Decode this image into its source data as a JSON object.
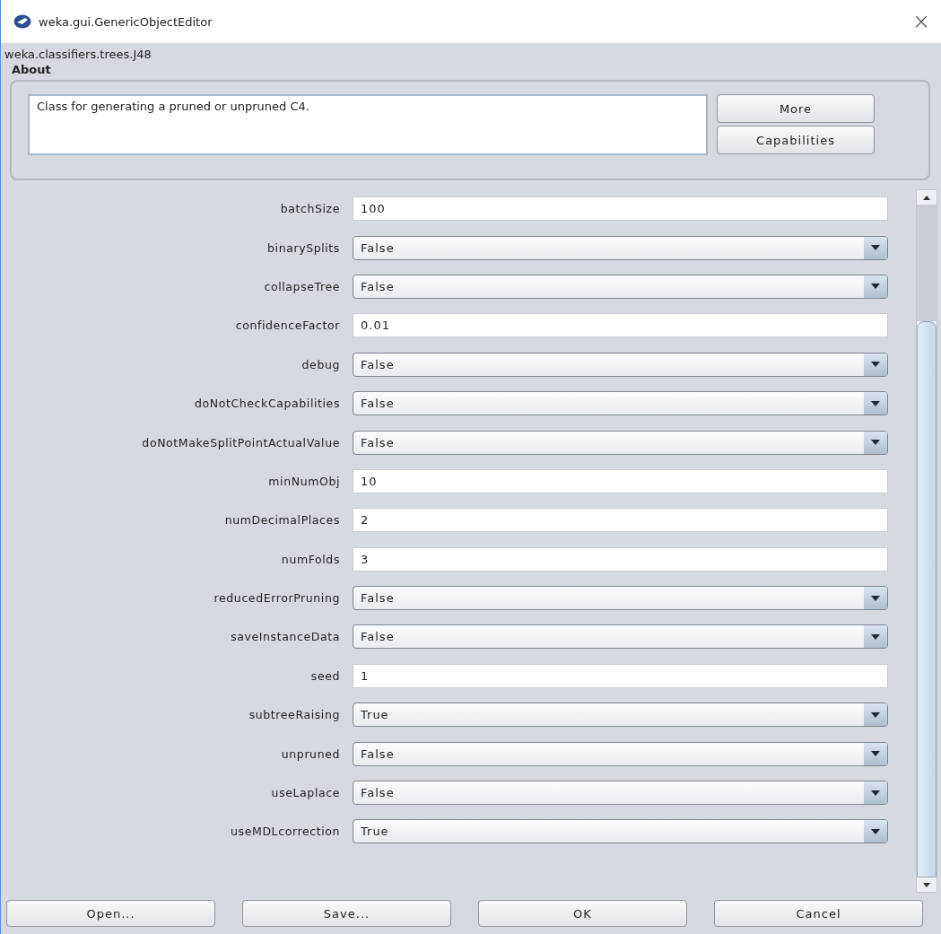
{
  "window": {
    "title": "weka.gui.GenericObjectEditor",
    "close": "×"
  },
  "class_name": "weka.classifiers.trees.J48",
  "about": {
    "heading": "About",
    "description": "Class for generating a pruned or unpruned C4.",
    "buttons": [
      "More",
      "Capabilities"
    ]
  },
  "properties": [
    {
      "label": "batchSize",
      "kind": "text",
      "value": "100"
    },
    {
      "label": "binarySplits",
      "kind": "dropdown",
      "value": "False"
    },
    {
      "label": "collapseTree",
      "kind": "dropdown",
      "value": "False"
    },
    {
      "label": "confidenceFactor",
      "kind": "text",
      "value": "0.01"
    },
    {
      "label": "debug",
      "kind": "dropdown",
      "value": "False"
    },
    {
      "label": "doNotCheckCapabilities",
      "kind": "dropdown",
      "value": "False"
    },
    {
      "label": "doNotMakeSplitPointActualValue",
      "kind": "dropdown",
      "value": "False"
    },
    {
      "label": "minNumObj",
      "kind": "text",
      "value": "10"
    },
    {
      "label": "numDecimalPlaces",
      "kind": "text",
      "value": "2"
    },
    {
      "label": "numFolds",
      "kind": "text",
      "value": "3"
    },
    {
      "label": "reducedErrorPruning",
      "kind": "dropdown",
      "value": "False"
    },
    {
      "label": "saveInstanceData",
      "kind": "dropdown",
      "value": "False"
    },
    {
      "label": "seed",
      "kind": "text",
      "value": "1"
    },
    {
      "label": "subtreeRaising",
      "kind": "dropdown",
      "value": "True"
    },
    {
      "label": "unpruned",
      "kind": "dropdown",
      "value": "False"
    },
    {
      "label": "useLaplace",
      "kind": "dropdown",
      "value": "False"
    },
    {
      "label": "useMDLcorrection",
      "kind": "dropdown",
      "value": "True"
    }
  ],
  "buttons": [
    "Open...",
    "Save...",
    "OK",
    "Cancel"
  ]
}
